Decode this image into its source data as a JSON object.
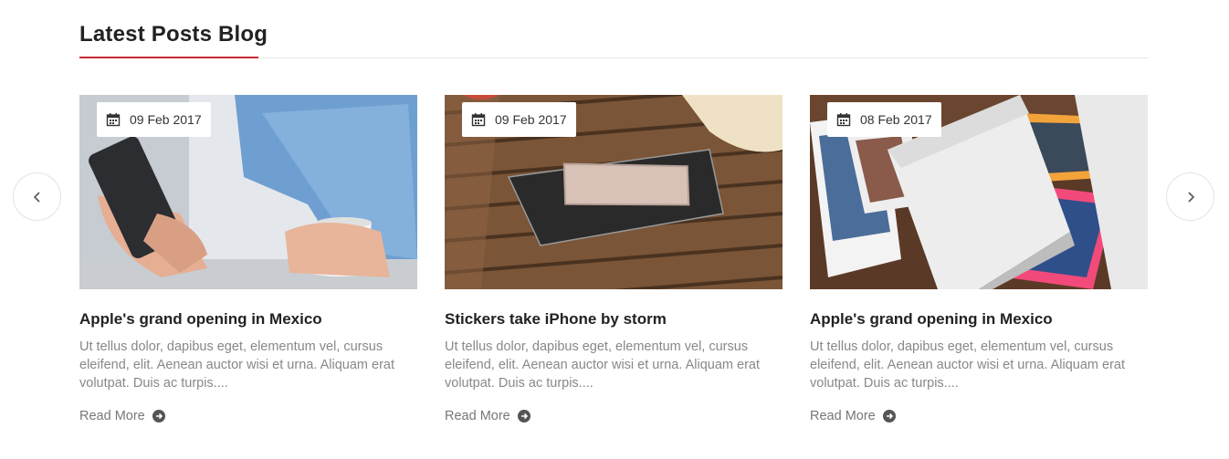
{
  "section": {
    "title": "Latest Posts Blog",
    "accent_color": "#c62a35"
  },
  "nav": {
    "prev_icon": "chevron-left-icon",
    "next_icon": "chevron-right-icon"
  },
  "posts": [
    {
      "date": "09 Feb 2017",
      "title": "Apple's grand opening in Mexico",
      "excerpt": "Ut tellus dolor, dapibus eget, elementum vel, cursus eleifend, elit. Aenean auctor wisi et urna. Aliquam erat volutpat. Duis ac turpis....",
      "read_more": "Read More",
      "image": "man holding phone with coffee cup"
    },
    {
      "date": "09 Feb 2017",
      "title": "Stickers take iPhone by storm",
      "excerpt": "Ut tellus dolor, dapibus eget, elementum vel, cursus eleifend, elit. Aenean auctor wisi et urna. Aliquam erat volutpat. Duis ac turpis....",
      "read_more": "Read More",
      "image": "phone on tablet on wooden table"
    },
    {
      "date": "08 Feb 2017",
      "title": "Apple's grand opening in Mexico",
      "excerpt": "Ut tellus dolor, dapibus eget, elementum vel, cursus eleifend, elit. Aenean auctor wisi et urna. Aliquam erat volutpat. Duis ac turpis....",
      "read_more": "Read More",
      "image": "instant photo printer with prints"
    }
  ]
}
